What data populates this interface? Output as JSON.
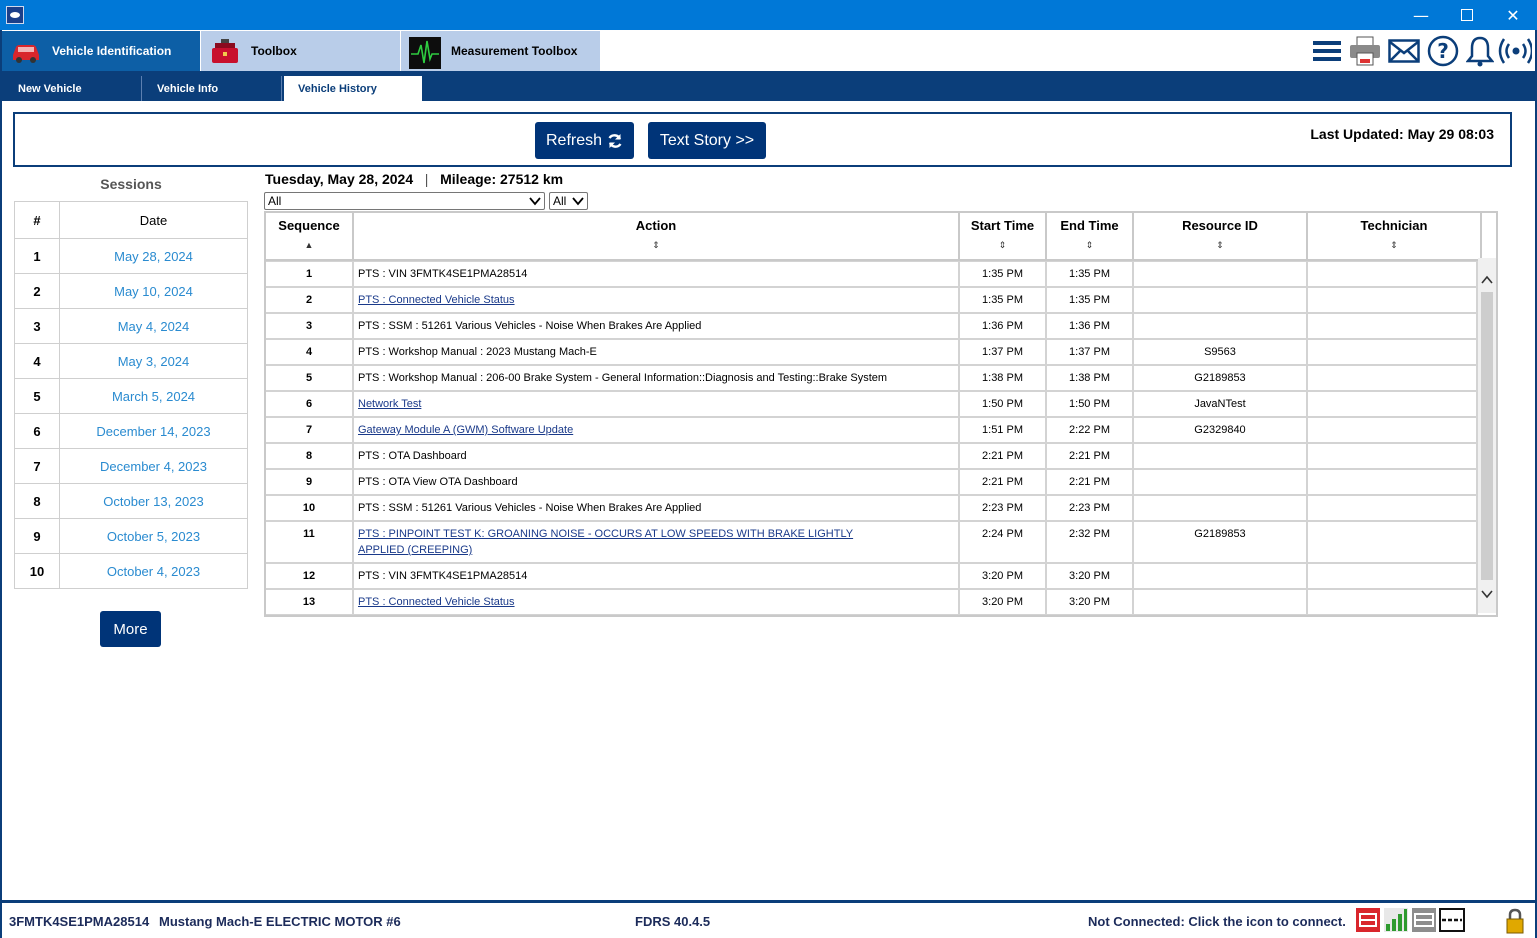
{
  "window": {
    "controls": [
      "minimize",
      "maximize",
      "close"
    ]
  },
  "app_tabs": [
    {
      "label": "Vehicle Identification",
      "icon": "car-icon",
      "active": true
    },
    {
      "label": "Toolbox",
      "icon": "toolbox-icon",
      "active": false
    },
    {
      "label": "Measurement Toolbox",
      "icon": "waveform-icon",
      "active": false
    }
  ],
  "top_icons": [
    "menu-icon",
    "printer-icon",
    "mail-icon",
    "help-icon",
    "bell-icon",
    "wireless-icon"
  ],
  "sub_tabs": [
    {
      "label": "New Vehicle",
      "active": false
    },
    {
      "label": "Vehicle Info",
      "active": false
    },
    {
      "label": "Vehicle History",
      "active": true
    }
  ],
  "toolbar": {
    "refresh_label": "Refresh",
    "text_story_label": "Text Story >>",
    "last_updated": "Last Updated: May 29 08:03"
  },
  "sessions": {
    "title": "Sessions",
    "headers": [
      "#",
      "Date"
    ],
    "rows": [
      {
        "num": "1",
        "date": "May 28, 2024"
      },
      {
        "num": "2",
        "date": "May 10, 2024"
      },
      {
        "num": "3",
        "date": "May 4, 2024"
      },
      {
        "num": "4",
        "date": "May 3, 2024"
      },
      {
        "num": "5",
        "date": "March 5, 2024"
      },
      {
        "num": "6",
        "date": "December 14, 2023"
      },
      {
        "num": "7",
        "date": "December 4, 2023"
      },
      {
        "num": "8",
        "date": "October 13, 2023"
      },
      {
        "num": "9",
        "date": "October 5, 2023"
      },
      {
        "num": "10",
        "date": "October 4, 2023"
      }
    ],
    "more_label": "More"
  },
  "history": {
    "date": "Tuesday, May 28, 2024",
    "separator": "|",
    "mileage": "Mileage: 27512 km",
    "filter1": "All",
    "filter2": "All",
    "headers": [
      "Sequence",
      "Action",
      "Start Time",
      "End Time",
      "Resource ID",
      "Technician"
    ],
    "rows": [
      {
        "seq": "1",
        "action": "PTS : VIN 3FMTK4SE1PMA28514",
        "link": false,
        "start": "1:35 PM",
        "end": "1:35 PM",
        "resource": "",
        "tech": ""
      },
      {
        "seq": "2",
        "action": "PTS : Connected Vehicle Status",
        "link": true,
        "start": "1:35 PM",
        "end": "1:35 PM",
        "resource": "",
        "tech": ""
      },
      {
        "seq": "3",
        "action": "PTS : SSM : 51261 Various Vehicles - Noise When Brakes Are Applied",
        "link": false,
        "start": "1:36 PM",
        "end": "1:36 PM",
        "resource": "",
        "tech": ""
      },
      {
        "seq": "4",
        "action": "PTS : Workshop Manual : 2023 Mustang Mach-E",
        "link": false,
        "start": "1:37 PM",
        "end": "1:37 PM",
        "resource": "S9563",
        "tech": ""
      },
      {
        "seq": "5",
        "action": "PTS : Workshop Manual : 206-00 Brake System - General Information::Diagnosis and Testing::Brake System",
        "link": false,
        "start": "1:38 PM",
        "end": "1:38 PM",
        "resource": "G2189853",
        "tech": ""
      },
      {
        "seq": "6",
        "action": "Network Test",
        "link": true,
        "start": "1:50 PM",
        "end": "1:50 PM",
        "resource": "JavaNTest",
        "tech": ""
      },
      {
        "seq": "7",
        "action": "Gateway Module A (GWM) Software Update",
        "link": true,
        "start": "1:51 PM",
        "end": "2:22 PM",
        "resource": "G2329840",
        "tech": ""
      },
      {
        "seq": "8",
        "action": "PTS : OTA Dashboard",
        "link": false,
        "start": "2:21 PM",
        "end": "2:21 PM",
        "resource": "",
        "tech": ""
      },
      {
        "seq": "9",
        "action": "PTS : OTA View OTA Dashboard",
        "link": false,
        "start": "2:21 PM",
        "end": "2:21 PM",
        "resource": "",
        "tech": ""
      },
      {
        "seq": "10",
        "action": "PTS : SSM : 51261 Various Vehicles - Noise When Brakes Are Applied",
        "link": false,
        "start": "2:23 PM",
        "end": "2:23 PM",
        "resource": "",
        "tech": ""
      },
      {
        "seq": "11",
        "action": "PTS : PINPOINT TEST K: GROANING NOISE - OCCURS AT LOW SPEEDS WITH BRAKE LIGHTLY APPLIED (CREEPING)",
        "link": true,
        "start": "2:24 PM",
        "end": "2:32 PM",
        "resource": "G2189853",
        "tech": ""
      },
      {
        "seq": "12",
        "action": "PTS : VIN 3FMTK4SE1PMA28514",
        "link": false,
        "start": "3:20 PM",
        "end": "3:20 PM",
        "resource": "",
        "tech": ""
      },
      {
        "seq": "13",
        "action": "PTS : Connected Vehicle Status",
        "link": true,
        "start": "3:20 PM",
        "end": "3:20 PM",
        "resource": "",
        "tech": ""
      }
    ]
  },
  "status": {
    "vin": "3FMTK4SE1PMA28514",
    "model": "Mustang Mach-E ELECTRIC MOTOR #6",
    "version": "FDRS 40.4.5",
    "connection": "Not Connected: Click the icon to connect.",
    "icons": [
      "vci-disconnected-icon",
      "signal-bars-icon",
      "vci-adapter-icon",
      "dashed-line-icon",
      "lock-icon"
    ]
  },
  "colors": {
    "brand_blue": "#0b3e7a",
    "button_blue": "#003478",
    "title_bar": "#0078d7",
    "date_link": "#2a8bd0"
  }
}
